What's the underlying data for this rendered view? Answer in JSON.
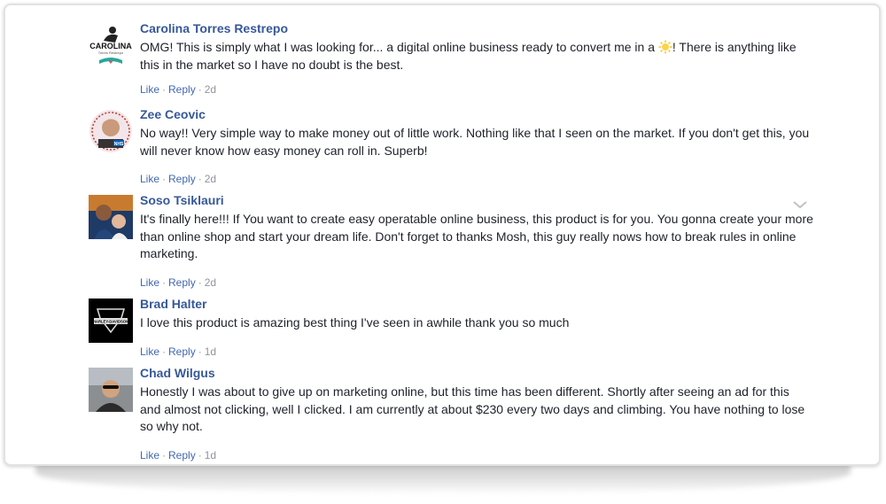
{
  "actions": {
    "like": "Like",
    "reply": "Reply",
    "separator": "·"
  },
  "comments": [
    {
      "name": "Carolina Torres Restrepo",
      "text_before": "OMG! This is simply what I was looking for... a digital online business ready to convert me in a ",
      "emoji": "sun-emoji",
      "text_after": "! There is anything like this in the market so I have no doubt is the best.",
      "age": "2d",
      "avatar_logo_text": "CAROLINA",
      "avatar_sub_text": "Torres Restrepo"
    },
    {
      "name": "Zee Ceovic",
      "text": "No way!! Very simple way to make money out of little work. Nothing like that I seen on the market. If you don't get this, you will never know how easy money can roll in. Superb!",
      "age": "2d",
      "avatar_badge_text": "NHS"
    },
    {
      "name": "Soso Tsiklauri",
      "text": "It's finally here!!! If You want to create easy operatable online business, this product is for you. You gonna create your more than online shop and start your dream life. Don't forget to thanks Mosh, this guy really nows how to break rules in online marketing.",
      "age": "2d"
    },
    {
      "name": "Brad Halter",
      "text": "I love this product is amazing best thing I've seen in awhile thank you so much",
      "age": "1d",
      "avatar_logo_text": "HARLEY-DAVIDSON"
    },
    {
      "name": "Chad Wilgus",
      "text": "Honestly I was about to give up on marketing online, but this time has been different. Shortly after seeing an ad for this and almost not clicking, well I clicked. I am currently at about $230 every two days and climbing. You have nothing to lose so why not.",
      "age": "1d"
    }
  ],
  "icons": {
    "options": "chevron-down-icon",
    "emoji": "sun-emoji"
  },
  "colors": {
    "name": "#365899",
    "link": "#4267b2",
    "meta": "#90949c",
    "text": "#1d2129"
  }
}
